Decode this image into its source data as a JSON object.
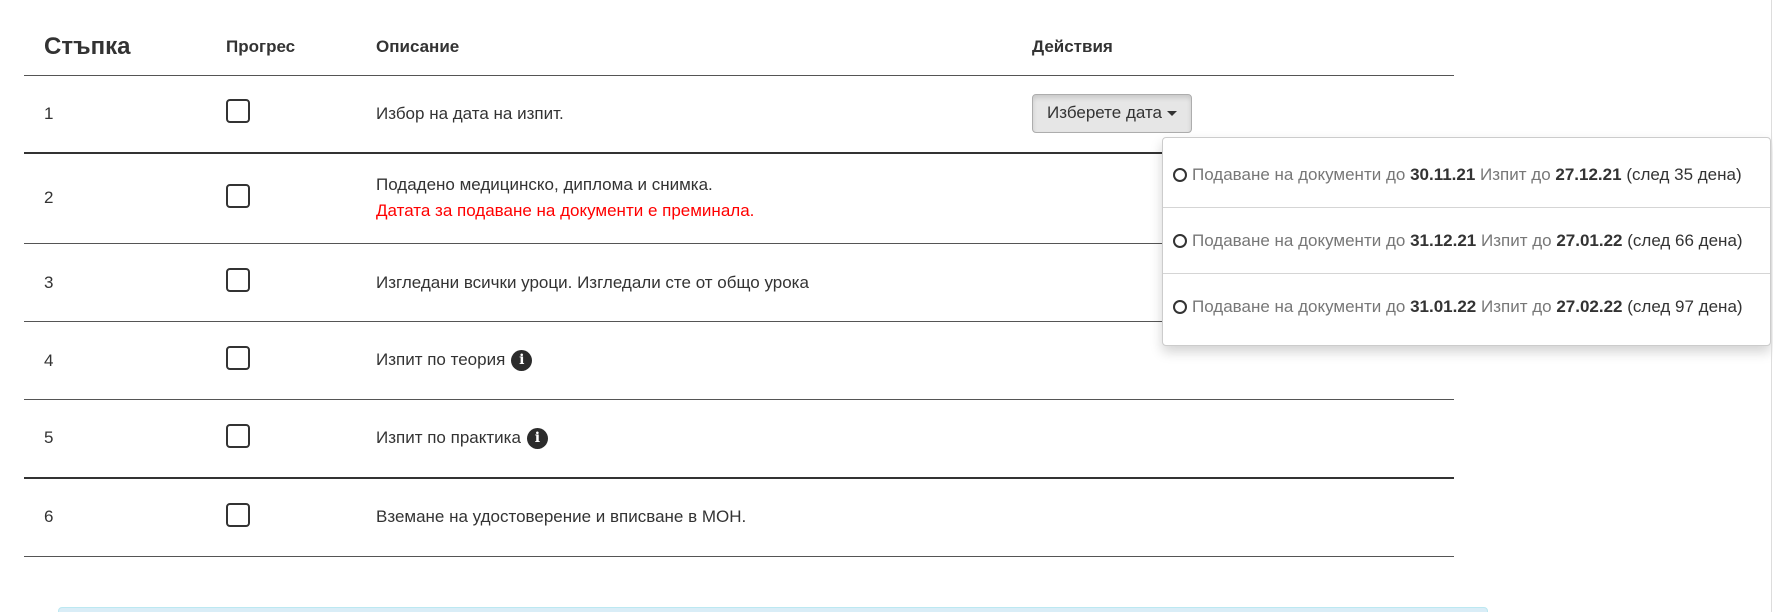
{
  "table": {
    "headers": {
      "step": "Стъпка",
      "progress": "Прогрес",
      "description": "Описание",
      "actions": "Действия"
    },
    "rows": [
      {
        "num": "1",
        "text": "Избор на дата на изпит.",
        "error": "",
        "checked": false
      },
      {
        "num": "2",
        "text": "Подадено медицинско, диплома и снимка.",
        "error": "Датата за подаване на документи е преминала.",
        "checked": false
      },
      {
        "num": "3",
        "text": "Изгледани всички уроци. Изгледали сте от общо урока",
        "error": "",
        "checked": false
      },
      {
        "num": "4",
        "text": "Изпит по теория",
        "error": "",
        "checked": false,
        "info_icon": "info-circle-icon"
      },
      {
        "num": "5",
        "text": "Изпит по практика",
        "error": "",
        "checked": false,
        "info_icon": "info-circle-icon"
      },
      {
        "num": "6",
        "text": "Вземане на удостоверение и вписване в МОН.",
        "error": "",
        "checked": false
      }
    ]
  },
  "dropdown": {
    "button_label": "Изберете дата",
    "options": [
      {
        "docs_label": "Подаване на документи до",
        "docs_date": "30.11.21",
        "exam_label": "Изпит до",
        "exam_date": "27.12.21",
        "days": "(след 35 дена)"
      },
      {
        "docs_label": "Подаване на документи до",
        "docs_date": "31.12.21",
        "exam_label": "Изпит до",
        "exam_date": "27.01.22",
        "days": "(след 66 дена)"
      },
      {
        "docs_label": "Подаване на документи до",
        "docs_date": "31.01.22",
        "exam_label": "Изпит до",
        "exam_date": "27.02.22",
        "days": "(след 97 дена)"
      }
    ]
  },
  "colors": {
    "text": "#333333",
    "error": "#ff0000",
    "muted": "#777777",
    "button_bg": "#e6e6e6",
    "alert_border": "#bce8f1"
  }
}
